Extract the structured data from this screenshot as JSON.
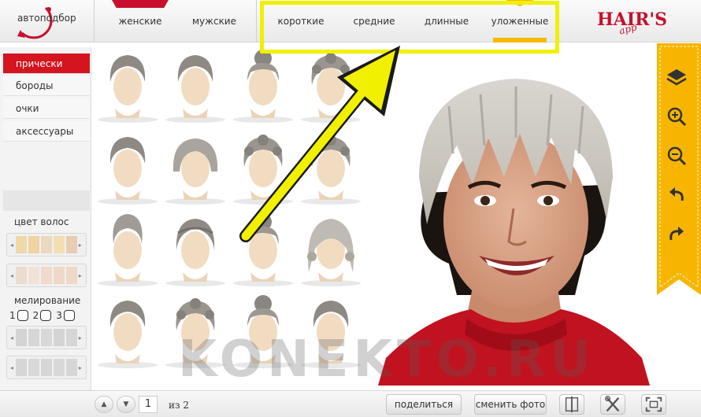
{
  "topbar": {
    "autopick_label": "автоподбор",
    "gender_tabs": [
      {
        "label": "женские",
        "active": true
      },
      {
        "label": "мужские",
        "active": false
      }
    ],
    "length_tabs": [
      {
        "label": "короткие"
      },
      {
        "label": "средние"
      },
      {
        "label": "длинные"
      },
      {
        "label": "уложенные",
        "active": true
      }
    ],
    "brand": "HAIR'S",
    "brand_sub": "app"
  },
  "sidebar": {
    "menu": [
      {
        "label": "прически",
        "active": true
      },
      {
        "label": "бороды"
      },
      {
        "label": "очки"
      },
      {
        "label": "аксессуары"
      }
    ],
    "hair_color_label": "цвет волос",
    "highlight_label": "мелирование",
    "highlight_options": [
      "1",
      "2",
      "3"
    ],
    "swatch_rows": [
      [
        "#f0d9a8",
        "#efd3a0",
        "#ead8c0",
        "#f3deb4",
        "#e8ccb4"
      ],
      [
        "#ecdcd0",
        "#f2e2d6",
        "#efdacb",
        "#eed8c8",
        "#f0d8c6"
      ],
      [
        "#d4d4d4",
        "#d6d6d6",
        "#d8d8d8",
        "#d4d4d4",
        "#d6d6d6"
      ],
      [
        "#d6d6d6",
        "#d8d8d8",
        "#d6d6d6",
        "#d8d8d8",
        "#d6d6d6"
      ]
    ]
  },
  "bottombar": {
    "page_current": "1",
    "page_of": "из 2",
    "share_label": "поделиться",
    "change_photo_label": "сменить фото"
  },
  "watermark": "KONEKTO.RU",
  "colors": {
    "accent_red": "#d4141e",
    "accent_yellow": "#f6b800",
    "highlight_yellow": "#f0f000"
  },
  "icons": {
    "toolbar": [
      "layers-icon",
      "zoom-in-icon",
      "zoom-out-icon",
      "undo-icon",
      "redo-icon"
    ],
    "bottom": [
      "compare-icon",
      "tools-icon",
      "fullscreen-icon"
    ]
  }
}
